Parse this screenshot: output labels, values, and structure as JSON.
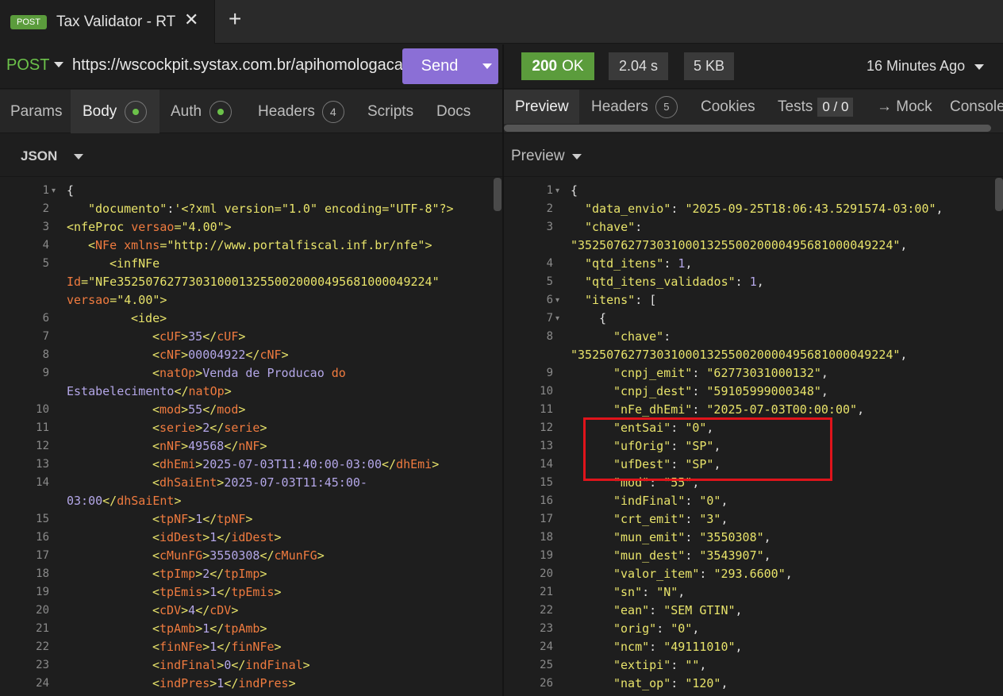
{
  "tab": {
    "method": "POST",
    "title": "Tax Validator - RT",
    "close": "✕",
    "add": "+"
  },
  "request": {
    "method": "POST",
    "url": "https://wscockpit.systax.com.br/apihomologacao",
    "send_label": "Send"
  },
  "response_status": {
    "code": "200",
    "text": "OK",
    "time": "2.04 s",
    "size": "5 KB",
    "ago": "16 Minutes Ago"
  },
  "request_tabs": {
    "params": "Params",
    "body": "Body",
    "auth": "Auth",
    "headers": "Headers",
    "headers_count": "4",
    "scripts": "Scripts",
    "docs": "Docs"
  },
  "response_tabs": {
    "preview": "Preview",
    "headers": "Headers",
    "headers_count": "5",
    "cookies": "Cookies",
    "tests": "Tests",
    "tests_count": "0 / 0",
    "mock": "→ Mock",
    "console": "Console"
  },
  "body_format": "JSON",
  "preview_mode": "Preview",
  "left_lines": [
    {
      "n": "1",
      "fold": true,
      "i": 0,
      "segs": [
        [
          "p",
          "{"
        ]
      ]
    },
    {
      "n": "2",
      "i": 1,
      "segs": [
        [
          "k",
          "\"documento\""
        ],
        [
          "p",
          ":"
        ],
        [
          "s",
          "'<?xml version=\"1.0\" encoding=\"UTF-8\"?>"
        ]
      ]
    },
    {
      "n": "3",
      "i": 0,
      "segs": [
        [
          "s",
          "<nfeProc "
        ],
        [
          "a",
          "versao"
        ],
        [
          "s",
          "=\"4.00\">"
        ]
      ]
    },
    {
      "n": "4",
      "i": 1,
      "segs": [
        [
          "s",
          "<"
        ],
        [
          "a",
          "NFe "
        ],
        [
          "a",
          "xmlns"
        ],
        [
          "s",
          "=\"http://www.portalfiscal.inf.br/nfe\">"
        ]
      ]
    },
    {
      "n": "5",
      "i": 2,
      "segs": [
        [
          "s",
          "<infNFe"
        ]
      ]
    },
    {
      "n": "",
      "i": 0,
      "segs": [
        [
          "a",
          "Id"
        ],
        [
          "s",
          "=\"NFe35250762773031000132550020000495681000049224\""
        ]
      ]
    },
    {
      "n": "",
      "i": 0,
      "segs": [
        [
          "a",
          "versao"
        ],
        [
          "s",
          "=\"4.00\">"
        ]
      ]
    },
    {
      "n": "6",
      "i": 3,
      "segs": [
        [
          "s",
          "<ide>"
        ]
      ]
    },
    {
      "n": "7",
      "i": 4,
      "segs": [
        [
          "s",
          "<"
        ],
        [
          "t",
          "cUF"
        ],
        [
          "s",
          ">"
        ],
        [
          "x",
          "35"
        ],
        [
          "s",
          "</"
        ],
        [
          "t",
          "cUF"
        ],
        [
          "s",
          ">"
        ]
      ]
    },
    {
      "n": "8",
      "i": 4,
      "segs": [
        [
          "s",
          "<"
        ],
        [
          "t",
          "cNF"
        ],
        [
          "s",
          ">"
        ],
        [
          "x",
          "00004922"
        ],
        [
          "s",
          "</"
        ],
        [
          "t",
          "cNF"
        ],
        [
          "s",
          ">"
        ]
      ]
    },
    {
      "n": "9",
      "i": 4,
      "segs": [
        [
          "s",
          "<"
        ],
        [
          "t",
          "natOp"
        ],
        [
          "s",
          ">"
        ],
        [
          "x",
          "Venda de Producao "
        ],
        [
          "t",
          "do"
        ]
      ]
    },
    {
      "n": "",
      "i": 0,
      "segs": [
        [
          "x",
          "Estabelecimento"
        ],
        [
          "s",
          "</"
        ],
        [
          "t",
          "natOp"
        ],
        [
          "s",
          ">"
        ]
      ]
    },
    {
      "n": "10",
      "i": 4,
      "segs": [
        [
          "s",
          "<"
        ],
        [
          "t",
          "mod"
        ],
        [
          "s",
          ">"
        ],
        [
          "x",
          "55"
        ],
        [
          "s",
          "</"
        ],
        [
          "t",
          "mod"
        ],
        [
          "s",
          ">"
        ]
      ]
    },
    {
      "n": "11",
      "i": 4,
      "segs": [
        [
          "s",
          "<"
        ],
        [
          "t",
          "serie"
        ],
        [
          "s",
          ">"
        ],
        [
          "x",
          "2"
        ],
        [
          "s",
          "</"
        ],
        [
          "t",
          "serie"
        ],
        [
          "s",
          ">"
        ]
      ]
    },
    {
      "n": "12",
      "i": 4,
      "segs": [
        [
          "s",
          "<"
        ],
        [
          "t",
          "nNF"
        ],
        [
          "s",
          ">"
        ],
        [
          "x",
          "49568"
        ],
        [
          "s",
          "</"
        ],
        [
          "t",
          "nNF"
        ],
        [
          "s",
          ">"
        ]
      ]
    },
    {
      "n": "13",
      "i": 4,
      "segs": [
        [
          "s",
          "<"
        ],
        [
          "t",
          "dhEmi"
        ],
        [
          "s",
          ">"
        ],
        [
          "x",
          "2025-07-03T11:40:00-03:00"
        ],
        [
          "s",
          "</"
        ],
        [
          "t",
          "dhEmi"
        ],
        [
          "s",
          ">"
        ]
      ]
    },
    {
      "n": "14",
      "i": 4,
      "segs": [
        [
          "s",
          "<"
        ],
        [
          "t",
          "dhSaiEnt"
        ],
        [
          "s",
          ">"
        ],
        [
          "x",
          "2025-07-03T11:45:00-"
        ]
      ]
    },
    {
      "n": "",
      "i": 0,
      "segs": [
        [
          "x",
          "03:00"
        ],
        [
          "s",
          "</"
        ],
        [
          "t",
          "dhSaiEnt"
        ],
        [
          "s",
          ">"
        ]
      ]
    },
    {
      "n": "15",
      "i": 4,
      "segs": [
        [
          "s",
          "<"
        ],
        [
          "t",
          "tpNF"
        ],
        [
          "s",
          ">"
        ],
        [
          "x",
          "1"
        ],
        [
          "s",
          "</"
        ],
        [
          "t",
          "tpNF"
        ],
        [
          "s",
          ">"
        ]
      ]
    },
    {
      "n": "16",
      "i": 4,
      "segs": [
        [
          "s",
          "<"
        ],
        [
          "t",
          "idDest"
        ],
        [
          "s",
          ">"
        ],
        [
          "x",
          "1"
        ],
        [
          "s",
          "</"
        ],
        [
          "t",
          "idDest"
        ],
        [
          "s",
          ">"
        ]
      ]
    },
    {
      "n": "17",
      "i": 4,
      "segs": [
        [
          "s",
          "<"
        ],
        [
          "t",
          "cMunFG"
        ],
        [
          "s",
          ">"
        ],
        [
          "x",
          "3550308"
        ],
        [
          "s",
          "</"
        ],
        [
          "t",
          "cMunFG"
        ],
        [
          "s",
          ">"
        ]
      ]
    },
    {
      "n": "18",
      "i": 4,
      "segs": [
        [
          "s",
          "<"
        ],
        [
          "t",
          "tpImp"
        ],
        [
          "s",
          ">"
        ],
        [
          "x",
          "2"
        ],
        [
          "s",
          "</"
        ],
        [
          "t",
          "tpImp"
        ],
        [
          "s",
          ">"
        ]
      ]
    },
    {
      "n": "19",
      "i": 4,
      "segs": [
        [
          "s",
          "<"
        ],
        [
          "t",
          "tpEmis"
        ],
        [
          "s",
          ">"
        ],
        [
          "x",
          "1"
        ],
        [
          "s",
          "</"
        ],
        [
          "t",
          "tpEmis"
        ],
        [
          "s",
          ">"
        ]
      ]
    },
    {
      "n": "20",
      "i": 4,
      "segs": [
        [
          "s",
          "<"
        ],
        [
          "t",
          "cDV"
        ],
        [
          "s",
          ">"
        ],
        [
          "x",
          "4"
        ],
        [
          "s",
          "</"
        ],
        [
          "t",
          "cDV"
        ],
        [
          "s",
          ">"
        ]
      ]
    },
    {
      "n": "21",
      "i": 4,
      "segs": [
        [
          "s",
          "<"
        ],
        [
          "t",
          "tpAmb"
        ],
        [
          "s",
          ">"
        ],
        [
          "x",
          "1"
        ],
        [
          "s",
          "</"
        ],
        [
          "t",
          "tpAmb"
        ],
        [
          "s",
          ">"
        ]
      ]
    },
    {
      "n": "22",
      "i": 4,
      "segs": [
        [
          "s",
          "<"
        ],
        [
          "t",
          "finNFe"
        ],
        [
          "s",
          ">"
        ],
        [
          "x",
          "1"
        ],
        [
          "s",
          "</"
        ],
        [
          "t",
          "finNFe"
        ],
        [
          "s",
          ">"
        ]
      ]
    },
    {
      "n": "23",
      "i": 4,
      "segs": [
        [
          "s",
          "<"
        ],
        [
          "t",
          "indFinal"
        ],
        [
          "s",
          ">"
        ],
        [
          "x",
          "0"
        ],
        [
          "s",
          "</"
        ],
        [
          "t",
          "indFinal"
        ],
        [
          "s",
          ">"
        ]
      ]
    },
    {
      "n": "24",
      "i": 4,
      "segs": [
        [
          "s",
          "<"
        ],
        [
          "t",
          "indPres"
        ],
        [
          "s",
          ">"
        ],
        [
          "x",
          "1"
        ],
        [
          "s",
          "</"
        ],
        [
          "t",
          "indPres"
        ],
        [
          "s",
          ">"
        ]
      ]
    }
  ],
  "right_lines": [
    {
      "n": "1",
      "fold": true,
      "i": 0,
      "segs": [
        [
          "p",
          "{"
        ]
      ]
    },
    {
      "n": "2",
      "i": 1,
      "segs": [
        [
          "k",
          "\"data_envio\""
        ],
        [
          "p",
          ": "
        ],
        [
          "s",
          "\"2025-09-25T18:06:43.5291574-03:00\""
        ],
        [
          "p",
          ","
        ]
      ]
    },
    {
      "n": "3",
      "i": 1,
      "segs": [
        [
          "k",
          "\"chave\""
        ],
        [
          "p",
          ":"
        ]
      ]
    },
    {
      "n": "",
      "i": 0,
      "segs": [
        [
          "s",
          "\"35250762773031000132550020000495681000049224\""
        ],
        [
          "p",
          ","
        ]
      ]
    },
    {
      "n": "4",
      "i": 1,
      "segs": [
        [
          "k",
          "\"qtd_itens\""
        ],
        [
          "p",
          ": "
        ],
        [
          "x",
          "1"
        ],
        [
          "p",
          ","
        ]
      ]
    },
    {
      "n": "5",
      "i": 1,
      "segs": [
        [
          "k",
          "\"qtd_itens_validados\""
        ],
        [
          "p",
          ": "
        ],
        [
          "x",
          "1"
        ],
        [
          "p",
          ","
        ]
      ]
    },
    {
      "n": "6",
      "fold": true,
      "i": 1,
      "segs": [
        [
          "k",
          "\"itens\""
        ],
        [
          "p",
          ": ["
        ]
      ]
    },
    {
      "n": "7",
      "fold": true,
      "i": 2,
      "segs": [
        [
          "p",
          "{"
        ]
      ]
    },
    {
      "n": "8",
      "i": 3,
      "segs": [
        [
          "k",
          "\"chave\""
        ],
        [
          "p",
          ":"
        ]
      ]
    },
    {
      "n": "",
      "i": 0,
      "segs": [
        [
          "s",
          "\"35250762773031000132550020000495681000049224\""
        ],
        [
          "p",
          ","
        ]
      ]
    },
    {
      "n": "9",
      "i": 3,
      "segs": [
        [
          "k",
          "\"cnpj_emit\""
        ],
        [
          "p",
          ": "
        ],
        [
          "s",
          "\"62773031000132\""
        ],
        [
          "p",
          ","
        ]
      ]
    },
    {
      "n": "10",
      "i": 3,
      "segs": [
        [
          "k",
          "\"cnpj_dest\""
        ],
        [
          "p",
          ": "
        ],
        [
          "s",
          "\"59105999000348\""
        ],
        [
          "p",
          ","
        ]
      ]
    },
    {
      "n": "11",
      "i": 3,
      "segs": [
        [
          "k",
          "\"nFe_dhEmi\""
        ],
        [
          "p",
          ": "
        ],
        [
          "s",
          "\"2025-07-03T00:00:00\""
        ],
        [
          "p",
          ","
        ]
      ]
    },
    {
      "n": "12",
      "i": 3,
      "segs": [
        [
          "k",
          "\"entSai\""
        ],
        [
          "p",
          ": "
        ],
        [
          "s",
          "\"0\""
        ],
        [
          "p",
          ","
        ]
      ]
    },
    {
      "n": "13",
      "i": 3,
      "segs": [
        [
          "k",
          "\"ufOrig\""
        ],
        [
          "p",
          ": "
        ],
        [
          "s",
          "\"SP\""
        ],
        [
          "p",
          ","
        ]
      ]
    },
    {
      "n": "14",
      "i": 3,
      "segs": [
        [
          "k",
          "\"ufDest\""
        ],
        [
          "p",
          ": "
        ],
        [
          "s",
          "\"SP\""
        ],
        [
          "p",
          ","
        ]
      ]
    },
    {
      "n": "15",
      "i": 3,
      "segs": [
        [
          "k",
          "\"mod\""
        ],
        [
          "p",
          ": "
        ],
        [
          "s",
          "\"55\""
        ],
        [
          "p",
          ","
        ]
      ]
    },
    {
      "n": "16",
      "i": 3,
      "segs": [
        [
          "k",
          "\"indFinal\""
        ],
        [
          "p",
          ": "
        ],
        [
          "s",
          "\"0\""
        ],
        [
          "p",
          ","
        ]
      ]
    },
    {
      "n": "17",
      "i": 3,
      "segs": [
        [
          "k",
          "\"crt_emit\""
        ],
        [
          "p",
          ": "
        ],
        [
          "s",
          "\"3\""
        ],
        [
          "p",
          ","
        ]
      ]
    },
    {
      "n": "18",
      "i": 3,
      "segs": [
        [
          "k",
          "\"mun_emit\""
        ],
        [
          "p",
          ": "
        ],
        [
          "s",
          "\"3550308\""
        ],
        [
          "p",
          ","
        ]
      ]
    },
    {
      "n": "19",
      "i": 3,
      "segs": [
        [
          "k",
          "\"mun_dest\""
        ],
        [
          "p",
          ": "
        ],
        [
          "s",
          "\"3543907\""
        ],
        [
          "p",
          ","
        ]
      ]
    },
    {
      "n": "20",
      "i": 3,
      "segs": [
        [
          "k",
          "\"valor_item\""
        ],
        [
          "p",
          ": "
        ],
        [
          "s",
          "\"293.6600\""
        ],
        [
          "p",
          ","
        ]
      ]
    },
    {
      "n": "21",
      "i": 3,
      "segs": [
        [
          "k",
          "\"sn\""
        ],
        [
          "p",
          ": "
        ],
        [
          "s",
          "\"N\""
        ],
        [
          "p",
          ","
        ]
      ]
    },
    {
      "n": "22",
      "i": 3,
      "segs": [
        [
          "k",
          "\"ean\""
        ],
        [
          "p",
          ": "
        ],
        [
          "s",
          "\"SEM GTIN\""
        ],
        [
          "p",
          ","
        ]
      ]
    },
    {
      "n": "23",
      "i": 3,
      "segs": [
        [
          "k",
          "\"orig\""
        ],
        [
          "p",
          ": "
        ],
        [
          "s",
          "\"0\""
        ],
        [
          "p",
          ","
        ]
      ]
    },
    {
      "n": "24",
      "i": 3,
      "segs": [
        [
          "k",
          "\"ncm\""
        ],
        [
          "p",
          ": "
        ],
        [
          "s",
          "\"49111010\""
        ],
        [
          "p",
          ","
        ]
      ]
    },
    {
      "n": "25",
      "i": 3,
      "segs": [
        [
          "k",
          "\"extipi\""
        ],
        [
          "p",
          ": "
        ],
        [
          "s",
          "\"\""
        ],
        [
          "p",
          ","
        ]
      ]
    },
    {
      "n": "26",
      "i": 3,
      "segs": [
        [
          "k",
          "\"nat_op\""
        ],
        [
          "p",
          ": "
        ],
        [
          "s",
          "\"120\""
        ],
        [
          "p",
          ","
        ]
      ]
    }
  ],
  "colors": {
    "accent": "#8b6fd6",
    "ok": "#5b9c3c",
    "highlight": "#e0141b"
  }
}
